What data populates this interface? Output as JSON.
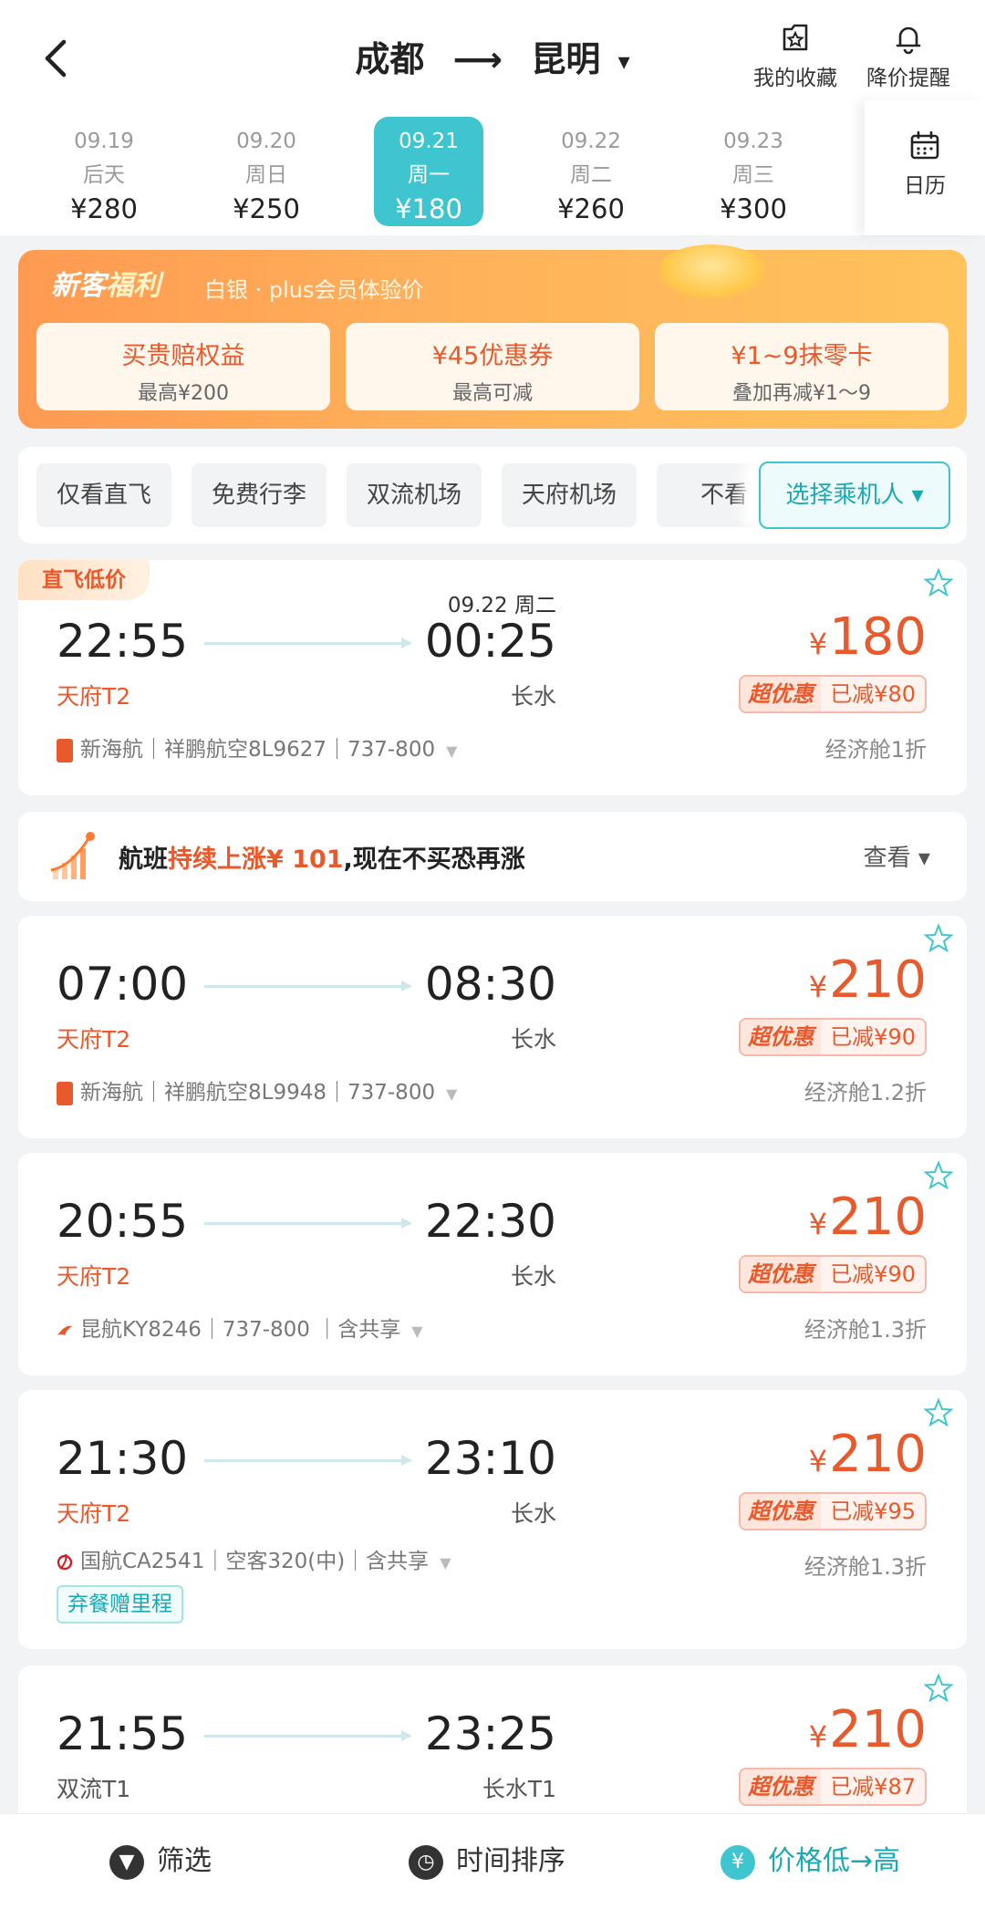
{
  "header": {
    "origin": "成都",
    "destination": "昆明",
    "route_arrow": "⟶",
    "caret": "▾",
    "favorites_label": "我的收藏",
    "price_alert_label": "降价提醒"
  },
  "dates": [
    {
      "date": "09.19",
      "day": "后天",
      "price": "¥280",
      "selected": false
    },
    {
      "date": "09.20",
      "day": "周日",
      "price": "¥250",
      "selected": false
    },
    {
      "date": "09.21",
      "day": "周一",
      "price": "¥180",
      "selected": true
    },
    {
      "date": "09.22",
      "day": "周二",
      "price": "¥260",
      "selected": false
    },
    {
      "date": "09.23",
      "day": "周三",
      "price": "¥300",
      "selected": false
    }
  ],
  "calendar_label": "日历",
  "promo": {
    "head_a": "新客",
    "head_b": "福利",
    "subtitle": "白银 · plus会员体验价",
    "cards": [
      {
        "title": "买贵赔权益",
        "sub": "最高¥200"
      },
      {
        "title": "¥45优惠券",
        "sub": "最高可减"
      },
      {
        "title": "¥1~9抹零卡",
        "sub": "叠加再减¥1～9"
      }
    ]
  },
  "filters": [
    "仅看直飞",
    "免费行李",
    "双流机场",
    "天府机场",
    "不看"
  ],
  "passenger_button": "选择乘机人 ▾",
  "trend": {
    "prefix": "航班",
    "highlight": "持续上涨¥ 101",
    "suffix": ",现在不买恐再涨",
    "view_label": "查看 ▾"
  },
  "flights": [
    {
      "tag": "直飞低价",
      "dep_time": "22:55",
      "arr_time": "00:25",
      "next_day": "09.22 周二",
      "dep_airport": "天府T2",
      "arr_airport": "长水",
      "price": "180",
      "yen": "¥",
      "badge_a": "超优惠",
      "badge_b": "已减¥80",
      "airline": "新海航｜祥鹏航空8L9627｜737-800",
      "airline_color": "#e8592b",
      "cabin": "经济舱1折"
    },
    {
      "dep_time": "07:00",
      "arr_time": "08:30",
      "dep_airport": "天府T2",
      "arr_airport": "长水",
      "price": "210",
      "yen": "¥",
      "badge_a": "超优惠",
      "badge_b": "已减¥90",
      "airline": "新海航｜祥鹏航空8L9948｜737-800",
      "airline_color": "#e8592b",
      "cabin": "经济舱1.2折"
    },
    {
      "dep_time": "20:55",
      "arr_time": "22:30",
      "dep_airport": "天府T2",
      "arr_airport": "长水",
      "price": "210",
      "yen": "¥",
      "badge_a": "超优惠",
      "badge_b": "已减¥90",
      "airline": "昆航KY8246｜737-800 ｜含共享",
      "airline_color": "#e8592b",
      "cabin": "经济舱1.3折"
    },
    {
      "dep_time": "21:30",
      "arr_time": "23:10",
      "dep_airport": "天府T2",
      "arr_airport": "长水",
      "price": "210",
      "yen": "¥",
      "badge_a": "超优惠",
      "badge_b": "已减¥95",
      "airline": "国航CA2541｜空客320(中)｜含共享",
      "airline_color": "#d21f26",
      "cabin": "经济舱1.3折",
      "perk": "弃餐赠里程"
    },
    {
      "dep_time": "21:55",
      "arr_time": "23:25",
      "dep_airport": "双流T1",
      "arr_airport": "长水T1",
      "price": "210",
      "yen": "¥",
      "badge_a": "超优惠",
      "badge_b": "已减¥87"
    }
  ],
  "bottom_bar": {
    "filter_icon": "▼",
    "filter_label": "筛选",
    "time_icon": "◷",
    "time_label": "时间排序",
    "price_icon": "¥",
    "price_label": "价格低→高"
  },
  "colors": {
    "accent": "#3ec5cf",
    "price": "#e8592b"
  }
}
